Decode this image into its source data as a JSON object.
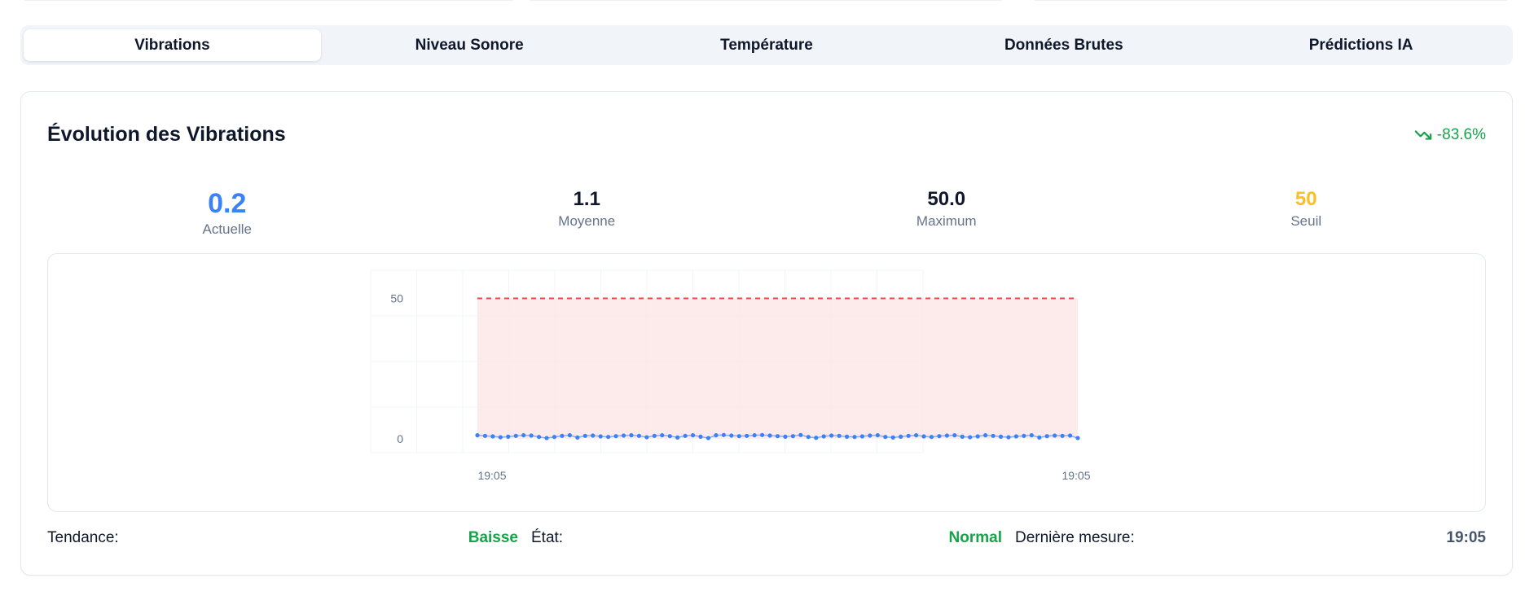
{
  "colors": {
    "accent_blue": "#3b82f6",
    "trend_green": "#16a34a",
    "threshold_red": "#ef4444",
    "threshold_fill": "#fde8e8",
    "seuil_amber": "#fbbf24"
  },
  "tabs": [
    {
      "label": "Vibrations",
      "active": true
    },
    {
      "label": "Niveau Sonore",
      "active": false
    },
    {
      "label": "Température",
      "active": false
    },
    {
      "label": "Données Brutes",
      "active": false
    },
    {
      "label": "Prédictions IA",
      "active": false
    }
  ],
  "card": {
    "title": "Évolution des Vibrations",
    "trend_icon": "trending-down-icon",
    "trend_value": "-83.6%"
  },
  "stats": {
    "current": {
      "value": "0.2",
      "label": "Actuelle"
    },
    "average": {
      "value": "1.1",
      "label": "Moyenne"
    },
    "maximum": {
      "value": "50.0",
      "label": "Maximum"
    },
    "threshold": {
      "value": "50",
      "label": "Seuil"
    }
  },
  "chart_data": {
    "type": "line",
    "x_tick_labels": [
      "19:05",
      "19:05"
    ],
    "y_ticks": [
      0,
      50
    ],
    "ylim": [
      -5,
      60
    ],
    "threshold": 50,
    "grid": true,
    "series": [
      {
        "values": [
          1.2,
          1.0,
          0.8,
          0.5,
          0.7,
          1.0,
          1.2,
          1.1,
          0.6,
          0.2,
          0.6,
          1.0,
          1.2,
          0.4,
          1.0,
          1.1,
          0.8,
          0.6,
          0.9,
          1.1,
          1.2,
          1.0,
          0.5,
          1.0,
          1.2,
          0.9,
          0.4,
          1.0,
          1.2,
          0.7,
          0.2,
          1.2,
          1.3,
          1.1,
          0.9,
          1.0,
          1.2,
          1.3,
          1.1,
          0.9,
          0.7,
          0.9,
          1.3,
          0.6,
          0.3,
          0.8,
          1.1,
          1.0,
          0.7,
          0.6,
          0.8,
          1.1,
          1.2,
          0.6,
          0.4,
          0.7,
          1.0,
          1.2,
          0.8,
          0.6,
          0.9,
          1.1,
          1.2,
          0.7,
          0.5,
          0.8,
          1.2,
          1.0,
          0.7,
          0.5,
          0.8,
          1.0,
          1.2,
          0.4,
          0.9,
          1.1,
          1.0,
          1.1,
          0.2
        ]
      }
    ]
  },
  "footer": {
    "trend_label": "Tendance:",
    "trend_value": "Baisse",
    "state_label": "État:",
    "state_value": "Normal",
    "last_label": "Dernière mesure:",
    "last_value": "19:05"
  }
}
